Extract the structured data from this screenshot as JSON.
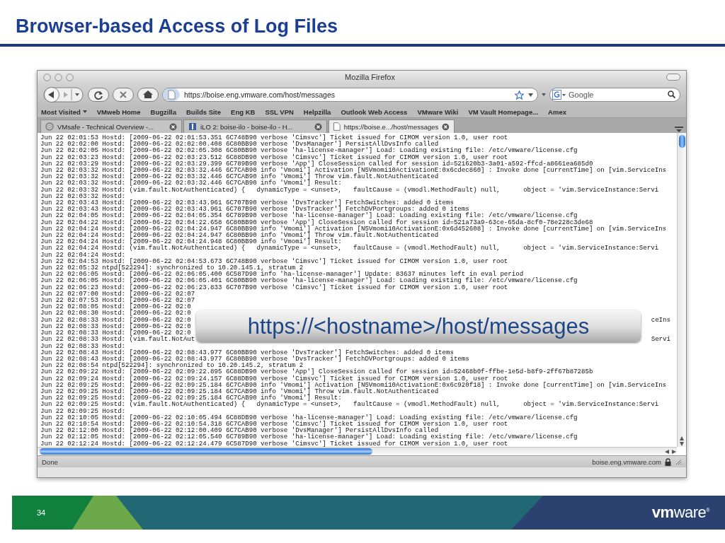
{
  "slide": {
    "title": "Browser-based Access of Log Files",
    "page_number": "34",
    "logo": "**vm**ware$^{®}$"
  },
  "browser": {
    "window_title": "Mozilla Firefox",
    "url": "https://boise.eng.vmware.com/host/messages",
    "search": {
      "placeholder": "Google"
    },
    "bookmarks": [
      {
        "label": "Most Visited",
        "menu": true
      },
      {
        "label": "VMweb Home",
        "menu": false
      },
      {
        "label": "Bugzilla",
        "menu": false
      },
      {
        "label": "Builds Site",
        "menu": false
      },
      {
        "label": "Eng KB",
        "menu": false
      },
      {
        "label": "SSL VPN",
        "menu": false
      },
      {
        "label": "Helpzilla",
        "menu": false
      },
      {
        "label": "Outlook Web Access",
        "menu": false
      },
      {
        "label": "VMware Wiki",
        "menu": false
      },
      {
        "label": "VM Vault Homepage...",
        "menu": false
      },
      {
        "label": "Amex",
        "menu": false
      }
    ],
    "tabs": [
      {
        "label": "VMsafe - Technical Overview -...",
        "kind": "swirl",
        "selected": false
      },
      {
        "label": "iLO 2: boise-ilo - boise-ilo - H...",
        "kind": "ilo",
        "selected": false
      },
      {
        "label": "https://boise.e.../host/messages",
        "kind": "page",
        "selected": true
      }
    ],
    "log_lines": [
      {
        "text": "Jun 22 02:01:53 Hostd: [2009-06-22 02:01:53.351 6C748B90 verbose 'Cimsvc'] Ticket issued for CIMOM version 1.0, user root"
      },
      {
        "text": "Jun 22 02:02:00 Hostd: [2009-06-22 02:02:00.408 6C80BB90 verbose 'DvsManager'] PersistAllDvsInfo called"
      },
      {
        "text": "Jun 22 02:02:05 Hostd: [2009-06-22 02:02:05.308 6C80BB90 verbose 'ha-license-manager'] Load: Loading existing file: /etc/vmware/license.cfg"
      },
      {
        "text": "Jun 22 02:03:23 Hostd: [2009-06-22 02:03:23.512 6C88DB90 verbose 'Cimsvc'] Ticket issued for CIMOM version 1.0, user root"
      },
      {
        "text": "Jun 22 02:03:29 Hostd: [2009-06-22 02:03:29.399 6C789B90 verbose 'App'] CloseSession called for session id=521620b3-3a01-a592-ffcd-a8661ea685d0"
      },
      {
        "text": "Jun 22 02:03:32 Hostd: [2009-06-22 02:03:32.446 6C7CAB90 info 'Vmomi'] Activation [N5Vmomi10ActivationE:0x6cdec860] : Invoke done [currentTime] on [vim.ServiceIns"
      },
      {
        "text": "Jun 22 02:03:32 Hostd: [2009-06-22 02:03:32.446 6C7CAB90 info 'Vmomi'] Throw vim.fault.NotAuthenticated"
      },
      {
        "text": "Jun 22 02:03:32 Hostd: [2009-06-22 02:03:32.446 6C7CAB90 info 'Vmomi'] Result:"
      },
      {
        "text": "Jun 22 02:03:32 Hostd: (vim.fault.NotAuthenticated) {   dynamicType = <unset>,   faultCause = (vmodl.MethodFault) null,      object = 'vim.ServiceInstance:Servi"
      },
      {
        "text": "Jun 22 02:03:32 Hostd:"
      },
      {
        "text": "Jun 22 02:03:43 Hostd: [2009-06-22 02:03:43.961 6C707B90 verbose 'DvsTracker'] FetchSwitches: added 0 items"
      },
      {
        "text": "Jun 22 02:03:43 Hostd: [2009-06-22 02:03:43.961 6C707B90 verbose 'DvsTracker'] FetchDVPortgroups: added 0 items"
      },
      {
        "text": "Jun 22 02:04:05 Hostd: [2009-06-22 02:04:05.354 6C789B90 verbose 'ha-license-manager'] Load: Loading existing file: /etc/vmware/license.cfg"
      },
      {
        "text": "Jun 22 02:04:22 Hostd: [2009-06-22 02:04:22.658 6C80BB90 verbose 'App'] CloseSession called for session id=521a73a9-63ce-65da-8cf0-78e228c3de68"
      },
      {
        "text": "Jun 22 02:04:24 Hostd: [2009-06-22 02:04:24.947 6C80BB90 info 'Vmomi'] Activation [N5Vmomi10ActivationE:0x6d452608] : Invoke done [currentTime] on [vim.ServiceIns"
      },
      {
        "text": "Jun 22 02:04:24 Hostd: [2009-06-22 02:04:24.947 6C80BB90 info 'Vmomi'] Throw vim.fault.NotAuthenticated"
      },
      {
        "text": "Jun 22 02:04:24 Hostd: [2009-06-22 02:04:24.948 6C80BB90 info 'Vmomi'] Result:"
      },
      {
        "text": "Jun 22 02:04:24 Hostd: (vim.fault.NotAuthenticated) {   dynamicType = <unset>,   faultCause = (vmodl.MethodFault) null,      object = 'vim.ServiceInstance:Servi"
      },
      {
        "text": "Jun 22 02:04:24 Hostd:"
      },
      {
        "text": "Jun 22 02:04:53 Hostd: [2009-06-22 02:04:53.673 6C748B90 verbose 'Cimsvc'] Ticket issued for CIMOM version 1.0, user root"
      },
      {
        "text": "Jun 22 02:05:32 ntpd[522294]: synchronized to 10.20.145.1, stratum 2"
      },
      {
        "text": "Jun 22 02:06:05 Hostd: [2009-06-22 02:06:05.400 6C587D90 info 'ha-license-manager'] Update: 83637 minutes left in eval period"
      },
      {
        "text": "Jun 22 02:06:05 Hostd: [2009-06-22 02:06:05.401 6C80BB90 verbose 'ha-license-manager'] Load: Loading existing file: /etc/vmware/license.cfg"
      },
      {
        "text": "Jun 22 02:06:23 Hostd: [2009-06-22 02:06:23.833 6C707B90 verbose 'Cimsvc'] Ticket issued for CIMOM version 1.0, user root"
      },
      {
        "text": "Jun 22 02:07:00 Hostd: [2009-06-22 02:07"
      },
      {
        "text": "Jun 22 02:07:53 Hostd: [2009-06-22 02:07"
      },
      {
        "text": "Jun 22 02:08:05 Hostd: [2009-06-22 02:0"
      },
      {
        "text": "Jun 22 02:08:30 Hostd: [2009-06-22 02:0"
      },
      {
        "text": "Jun 22 02:08:33 Hostd: [2009-06-22 02:0",
        "tail": "ceIns"
      },
      {
        "text": "Jun 22 02:08:33 Hostd: [2009-06-22 02:0"
      },
      {
        "text": "Jun 22 02:08:33 Hostd: [2009-06-22 02:0"
      },
      {
        "text": "Jun 22 02:08:33 Hostd: (vim.fault.NotAut",
        "tail": "Servi"
      },
      {
        "text": "Jun 22 02:08:33 Hostd:"
      },
      {
        "text": "Jun 22 02:08:43 Hostd: [2009-06-22 02:08:43.977 6C80BB90 verbose 'DvsTracker'] FetchSwitches: added 0 items"
      },
      {
        "text": "Jun 22 02:08:43 Hostd: [2009-06-22 02:08:43.977 6C80BB90 verbose 'DvsTracker'] FetchDVPortgroups: added 0 items"
      },
      {
        "text": "Jun 22 02:08:54 ntpd[522294]: synchronized to 10.20.145.2, stratum 2"
      },
      {
        "text": "Jun 22 02:09:22 Hostd: [2009-06-22 02:09:22.895 6C88DB90 verbose 'App'] CloseSession called for session id=52468b0f-ffbe-1e5d-b8f9-2ff67b87285b"
      },
      {
        "text": "Jun 22 02:09:24 Hostd: [2009-06-22 02:09:24.157 6C88DB90 verbose 'Cimsvc'] Ticket issued for CIMOM version 1.0, user root"
      },
      {
        "text": "Jun 22 02:09:25 Hostd: [2009-06-22 02:09:25.184 6C7CAB90 info 'Vmomi'] Activation [N5Vmomi10ActivationE:0x6c920f18] : Invoke done [currentTime] on [vim.ServiceIns"
      },
      {
        "text": "Jun 22 02:09:25 Hostd: [2009-06-22 02:09:25.184 6C7CAB90 info 'Vmomi'] Throw vim.fault.NotAuthenticated"
      },
      {
        "text": "Jun 22 02:09:25 Hostd: [2009-06-22 02:09:25.184 6C7CAB90 info 'Vmomi'] Result:"
      },
      {
        "text": "Jun 22 02:09:25 Hostd: (vim.fault.NotAuthenticated) {   dynamicType = <unset>,   faultCause = (vmodl.MethodFault) null,      object = 'vim.ServiceInstance:Servi"
      },
      {
        "text": "Jun 22 02:09:25 Hostd:"
      },
      {
        "text": "Jun 22 02:10:05 Hostd: [2009-06-22 02:10:05.494 6C88DB90 verbose 'ha-license-manager'] Load: Loading existing file: /etc/vmware/license.cfg"
      },
      {
        "text": "Jun 22 02:10:54 Hostd: [2009-06-22 02:10:54.318 6C7CAB90 verbose 'Cimsvc'] Ticket issued for CIMOM version 1.0, user root"
      },
      {
        "text": "Jun 22 02:12:00 Hostd: [2009-06-22 02:12:00.409 6C7CAB90 verbose 'DvsManager'] PersistAllDvsInfo called"
      },
      {
        "text": "Jun 22 02:12:05 Hostd: [2009-06-22 02:12:05.540 6C789B90 verbose 'ha-license-manager'] Load: Loading existing file: /etc/vmware/license.cfg"
      },
      {
        "text": "Jun 22 02:12:24 Hostd: [2009-06-22 02:12:24.479 6C587D90 verbose 'Cimsvc'] Ticket issued for CIMOM version 1.0, user root"
      }
    ],
    "callout": "https://<hostname>/host/messages",
    "status": {
      "text": "Done",
      "host": "boise.eng.vmware.com",
      "secure": true
    }
  }
}
